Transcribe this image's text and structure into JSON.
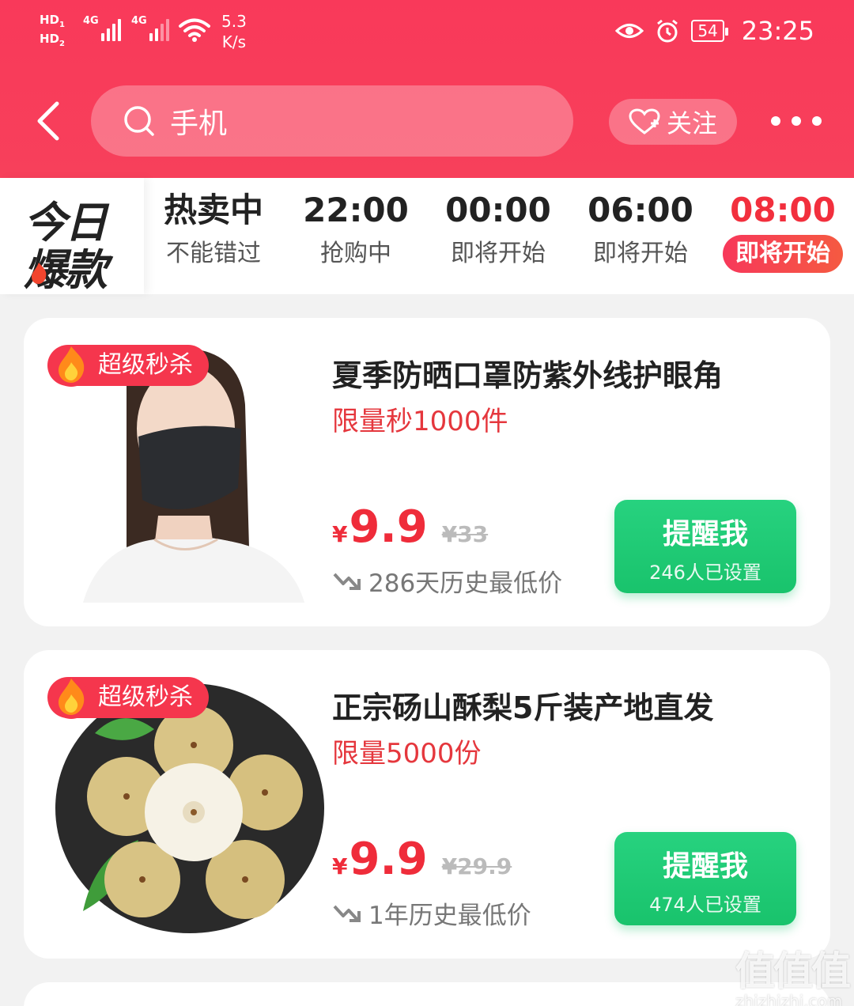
{
  "status_bar": {
    "hd1": "HD",
    "hd2": "HD",
    "net1": "4G",
    "net2": "4G",
    "speed_value": "5.3",
    "speed_unit": "K/s",
    "battery": "54",
    "time": "23:25"
  },
  "header": {
    "search_text": "手机",
    "follow_label": "关注"
  },
  "brand": {
    "line1": "今日",
    "line2": "爆款"
  },
  "tabs": [
    {
      "title": "热卖中",
      "sub": "不能错过"
    },
    {
      "title": "22:00",
      "sub": "抢购中"
    },
    {
      "title": "00:00",
      "sub": "即将开始"
    },
    {
      "title": "06:00",
      "sub": "即将开始"
    },
    {
      "title": "08:00",
      "sub": "即将开始"
    }
  ],
  "products": [
    {
      "badge": "超级秒杀",
      "title": "夏季防晒口罩防紫外线护眼角",
      "limit": "限量秒1000件",
      "currency": "¥",
      "price": "9.9",
      "orig_price": "¥33",
      "history": "286天历史最低价",
      "remind_label": "提醒我",
      "remind_count": "246人已设置"
    },
    {
      "badge": "超级秒杀",
      "title": "正宗砀山酥梨5斤装产地直发",
      "limit": "限量5000份",
      "currency": "¥",
      "price": "9.9",
      "orig_price": "¥29.9",
      "history": "1年历史最低价",
      "remind_label": "提醒我",
      "remind_count": "474人已设置"
    }
  ],
  "watermark": {
    "logo": "值值值",
    "site": "zhizhizhi.com"
  },
  "colors": {
    "header_red": "#f9395a",
    "price_red": "#ef2c3a",
    "remind_green": "#1fc873"
  }
}
